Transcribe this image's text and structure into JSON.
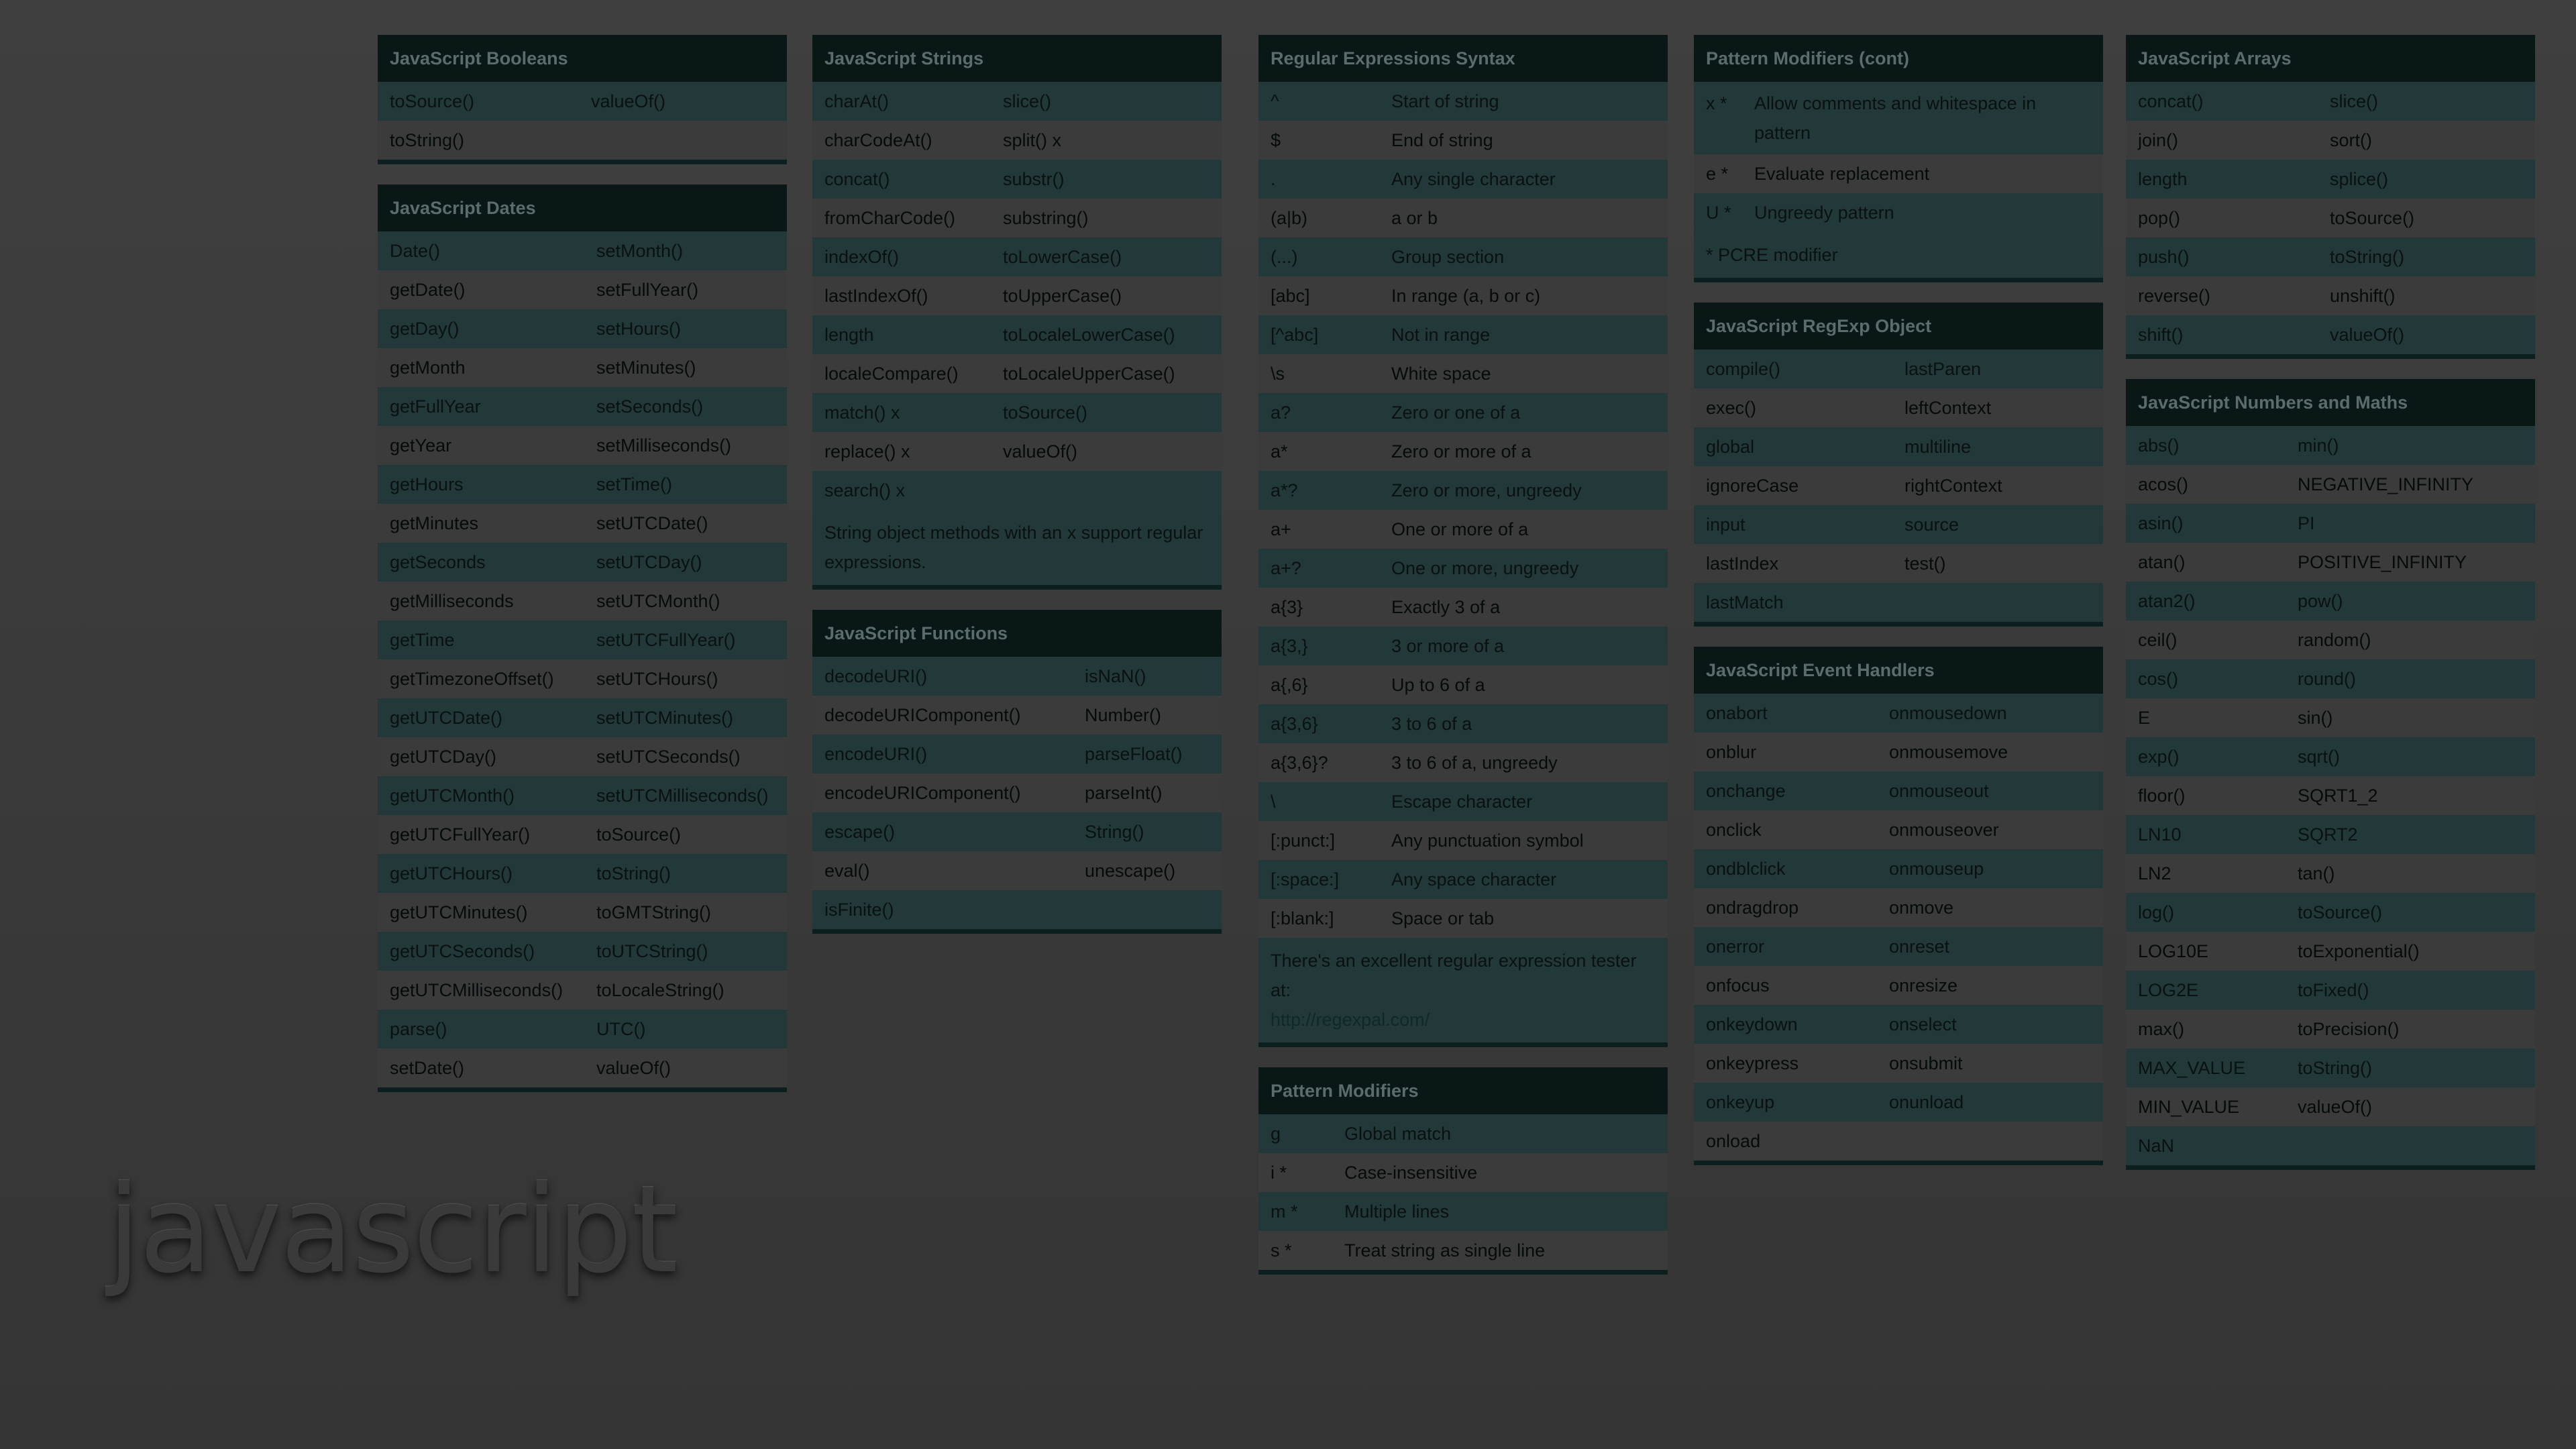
{
  "hero_title": "javascript",
  "colors": {
    "background": "#3b3b3b",
    "header": "#0a1717",
    "row_band": "#233838"
  },
  "columns": [
    {
      "cards": [
        {
          "title": "JavaScript Booleans",
          "rows": [
            [
              "toSource()",
              "valueOf()"
            ],
            [
              "toString()",
              ""
            ]
          ]
        },
        {
          "title": "JavaScript Dates",
          "rows": [
            [
              "Date()",
              "setMonth()"
            ],
            [
              "getDate()",
              "setFullYear()"
            ],
            [
              "getDay()",
              "setHours()"
            ],
            [
              "getMonth",
              "setMinutes()"
            ],
            [
              "getFullYear",
              "setSeconds()"
            ],
            [
              "getYear",
              "setMilliseconds()"
            ],
            [
              "getHours",
              "setTime()"
            ],
            [
              "getMinutes",
              "setUTCDate()"
            ],
            [
              "getSeconds",
              "setUTCDay()"
            ],
            [
              "getMilliseconds",
              "setUTCMonth()"
            ],
            [
              "getTime",
              "setUTCFullYear()"
            ],
            [
              "getTimezoneOffset()",
              "setUTCHours()"
            ],
            [
              "getUTCDate()",
              "setUTCMinutes()"
            ],
            [
              "getUTCDay()",
              "setUTCSeconds()"
            ],
            [
              "getUTCMonth()",
              "setUTCMilliseconds()"
            ],
            [
              "getUTCFullYear()",
              "toSource()"
            ],
            [
              "getUTCHours()",
              "toString()"
            ],
            [
              "getUTCMinutes()",
              "toGMTString()"
            ],
            [
              "getUTCSeconds()",
              "toUTCString()"
            ],
            [
              "getUTCMilliseconds()",
              "toLocaleString()"
            ],
            [
              "parse()",
              "UTC()"
            ],
            [
              "setDate()",
              "valueOf()"
            ]
          ]
        }
      ]
    },
    {
      "cards": [
        {
          "title": "JavaScript Strings",
          "rows": [
            [
              "charAt()",
              "slice()"
            ],
            [
              "charCodeAt()",
              "split() x"
            ],
            [
              "concat()",
              "substr()"
            ],
            [
              "fromCharCode()",
              "substring()"
            ],
            [
              "indexOf()",
              "toLowerCase()"
            ],
            [
              "lastIndexOf()",
              "toUpperCase()"
            ],
            [
              "length",
              "toLocaleLowerCase()"
            ],
            [
              "localeCompare()",
              "toLocaleUpperCase()"
            ],
            [
              "match() x",
              "toSource()"
            ],
            [
              "replace() x",
              "valueOf()"
            ],
            [
              "search() x",
              ""
            ]
          ],
          "note": "String object methods with an x support regular expressions."
        },
        {
          "title": "JavaScript Functions",
          "rows": [
            [
              "decodeURI()",
              "isNaN()"
            ],
            [
              "decodeURIComponent()",
              "Number()"
            ],
            [
              "encodeURI()",
              "parseFloat()"
            ],
            [
              "encodeURIComponent()",
              "parseInt()"
            ],
            [
              "escape()",
              "String()"
            ],
            [
              "eval()",
              "unescape()"
            ],
            [
              "isFinite()",
              ""
            ]
          ]
        }
      ]
    },
    {
      "cards": [
        {
          "title": "Regular Expressions Syntax",
          "rows": [
            [
              "^",
              "Start of string"
            ],
            [
              "$",
              "End of string"
            ],
            [
              ".",
              "Any single character"
            ],
            [
              "(a|b)",
              "a or b"
            ],
            [
              "(...)",
              "Group section"
            ],
            [
              "[abc]",
              "In range (a, b or c)"
            ],
            [
              "[^abc]",
              "Not in range"
            ],
            [
              "\\s",
              "White space"
            ],
            [
              "a?",
              "Zero or one of a"
            ],
            [
              "a*",
              "Zero or more of a"
            ],
            [
              "a*?",
              "Zero or more, ungreedy"
            ],
            [
              "a+",
              "One or more of a"
            ],
            [
              "a+?",
              "One or more, ungreedy"
            ],
            [
              "a{3}",
              "Exactly 3 of a"
            ],
            [
              "a{3,}",
              "3 or more of a"
            ],
            [
              "a{,6}",
              "Up to 6 of a"
            ],
            [
              "a{3,6}",
              "3 to 6 of a"
            ],
            [
              "a{3,6}?",
              "3 to 6 of a, ungreedy"
            ],
            [
              "\\",
              "Escape character"
            ],
            [
              "[:punct:]",
              "Any punctuation symbol"
            ],
            [
              "[:space:]",
              "Any space character"
            ],
            [
              "[:blank:]",
              "Space or tab"
            ]
          ],
          "note": "There's an excellent regular expression tester at:",
          "note_link": "http://regexpal.com/"
        },
        {
          "title": "Pattern Modifiers",
          "rows": [
            [
              "g",
              "Global match"
            ],
            [
              "i *",
              "Case-insensitive"
            ],
            [
              "m *",
              "Multiple lines"
            ],
            [
              "s *",
              "Treat string as single line"
            ]
          ]
        }
      ]
    },
    {
      "cards": [
        {
          "title": "Pattern Modifiers (cont)",
          "rows": [
            [
              "x *",
              "Allow comments and whitespace in pattern"
            ],
            [
              "e *",
              "Evaluate replacement"
            ],
            [
              "U *",
              "Ungreedy pattern"
            ]
          ],
          "note": "* PCRE modifier"
        },
        {
          "title": "JavaScript RegExp Object",
          "rows": [
            [
              "compile()",
              "lastParen"
            ],
            [
              "exec()",
              "leftContext"
            ],
            [
              "global",
              "multiline"
            ],
            [
              "ignoreCase",
              "rightContext"
            ],
            [
              "input",
              "source"
            ],
            [
              "lastIndex",
              "test()"
            ],
            [
              "lastMatch",
              ""
            ]
          ]
        },
        {
          "title": "JavaScript Event Handlers",
          "rows": [
            [
              "onabort",
              "onmousedown"
            ],
            [
              "onblur",
              "onmousemove"
            ],
            [
              "onchange",
              "onmouseout"
            ],
            [
              "onclick",
              "onmouseover"
            ],
            [
              "ondblclick",
              "onmouseup"
            ],
            [
              "ondragdrop",
              "onmove"
            ],
            [
              "onerror",
              "onreset"
            ],
            [
              "onfocus",
              "onresize"
            ],
            [
              "onkeydown",
              "onselect"
            ],
            [
              "onkeypress",
              "onsubmit"
            ],
            [
              "onkeyup",
              "onunload"
            ],
            [
              "onload",
              ""
            ]
          ]
        }
      ]
    },
    {
      "cards": [
        {
          "title": "JavaScript Arrays",
          "rows": [
            [
              "concat()",
              "slice()"
            ],
            [
              "join()",
              "sort()"
            ],
            [
              "length",
              "splice()"
            ],
            [
              "pop()",
              "toSource()"
            ],
            [
              "push()",
              "toString()"
            ],
            [
              "reverse()",
              "unshift()"
            ],
            [
              "shift()",
              "valueOf()"
            ]
          ]
        },
        {
          "title": "JavaScript Numbers and Maths",
          "rows": [
            [
              "abs()",
              "min()"
            ],
            [
              "acos()",
              "NEGATIVE_INFINITY"
            ],
            [
              "asin()",
              "PI"
            ],
            [
              "atan()",
              "POSITIVE_INFINITY"
            ],
            [
              "atan2()",
              "pow()"
            ],
            [
              "ceil()",
              "random()"
            ],
            [
              "cos()",
              "round()"
            ],
            [
              "E",
              "sin()"
            ],
            [
              "exp()",
              "sqrt()"
            ],
            [
              "floor()",
              "SQRT1_2"
            ],
            [
              "LN10",
              "SQRT2"
            ],
            [
              "LN2",
              "tan()"
            ],
            [
              "log()",
              "toSource()"
            ],
            [
              "LOG10E",
              "toExponential()"
            ],
            [
              "LOG2E",
              "toFixed()"
            ],
            [
              "max()",
              "toPrecision()"
            ],
            [
              "MAX_VALUE",
              "toString()"
            ],
            [
              "MIN_VALUE",
              "valueOf()"
            ],
            [
              "NaN",
              ""
            ]
          ]
        }
      ]
    }
  ]
}
